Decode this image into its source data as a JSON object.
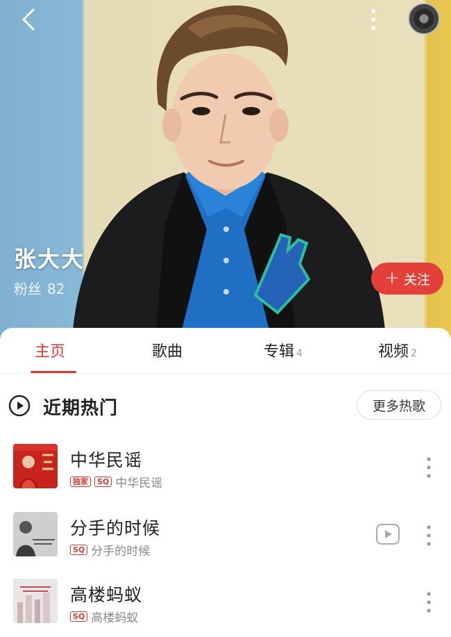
{
  "header": {
    "artist_name": "张大大",
    "fans_label": "粉丝",
    "fans_count": "82",
    "follow_label": "关注",
    "icons": [
      "back-chevron-icon",
      "more-vertical-icon",
      "now-playing-disc-icon"
    ]
  },
  "tabs": [
    {
      "label": "主页",
      "count": "",
      "active": true
    },
    {
      "label": "歌曲",
      "count": "",
      "active": false
    },
    {
      "label": "专辑",
      "count": "4",
      "active": false
    },
    {
      "label": "视频",
      "count": "2",
      "active": false
    }
  ],
  "section": {
    "title": "近期热门",
    "more_label": "更多热歌"
  },
  "songs": [
    {
      "title": "中华民谣",
      "badges": [
        "独家",
        "SQ"
      ],
      "album": "中华民谣",
      "has_mv": false
    },
    {
      "title": "分手的时候",
      "badges": [
        "SQ"
      ],
      "album": "分手的时候",
      "has_mv": true
    },
    {
      "title": "高楼蚂蚁",
      "badges": [
        "SQ"
      ],
      "album": "高楼蚂蚁",
      "has_mv": false
    }
  ],
  "colors": {
    "accent": "#e0392f",
    "follow_button": "#e4403a"
  }
}
